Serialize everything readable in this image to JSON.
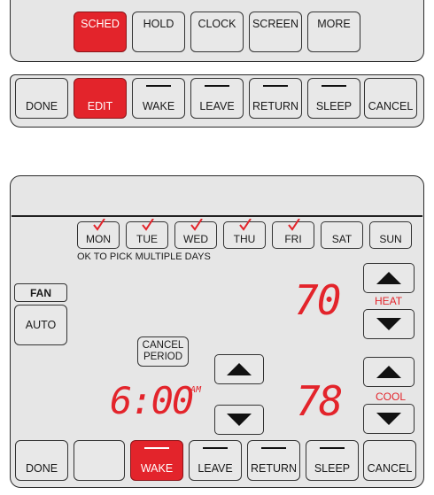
{
  "top_menu": {
    "buttons": [
      "SCHED",
      "HOLD",
      "CLOCK",
      "SCREEN",
      "MORE"
    ]
  },
  "schedule_edit_bar": {
    "done": "DONE",
    "edit": "EDIT",
    "wake": "WAKE",
    "leave": "LEAVE",
    "return": "RETURN",
    "sleep": "SLEEP",
    "cancel": "CANCEL"
  },
  "schedule_screen": {
    "days": [
      {
        "label": "MON",
        "checked": true
      },
      {
        "label": "TUE",
        "checked": true
      },
      {
        "label": "WED",
        "checked": true
      },
      {
        "label": "THU",
        "checked": true
      },
      {
        "label": "FRI",
        "checked": true
      },
      {
        "label": "SAT",
        "checked": false
      },
      {
        "label": "SUN",
        "checked": false
      }
    ],
    "multi_day_hint": "OK TO PICK MULTIPLE DAYS",
    "fan": {
      "label": "FAN",
      "mode": "AUTO"
    },
    "cancel_period": {
      "line1": "CANCEL",
      "line2": "PERIOD"
    },
    "time": {
      "value": "6:00",
      "ampm": "AM"
    },
    "heat": {
      "setpoint": "70",
      "label": "HEAT"
    },
    "cool": {
      "setpoint": "78",
      "label": "COOL"
    },
    "bottom_bar": {
      "done": "DONE",
      "blank": "",
      "wake": "WAKE",
      "leave": "LEAVE",
      "return": "RETURN",
      "sleep": "SLEEP",
      "cancel": "CANCEL"
    }
  },
  "colors": {
    "accent": "#e3242b",
    "panel": "#e6e6e6"
  }
}
